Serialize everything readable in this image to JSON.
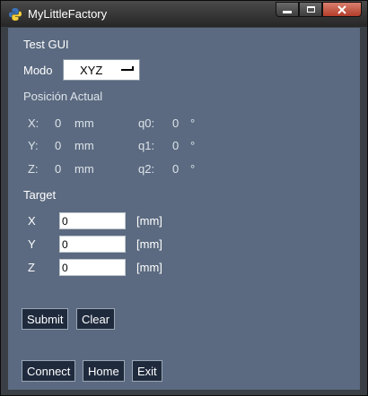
{
  "window": {
    "title": "MyLittleFactory"
  },
  "header": {
    "label": "Test GUI"
  },
  "mode": {
    "label": "Modo",
    "value": "XYZ"
  },
  "position": {
    "title": "Posición Actual",
    "rows": [
      {
        "axis": "X:",
        "value": "0",
        "unit": "mm",
        "joint": "q0:",
        "jvalue": "0",
        "junit": "°"
      },
      {
        "axis": "Y:",
        "value": "0",
        "unit": "mm",
        "joint": "q1:",
        "jvalue": "0",
        "junit": "°"
      },
      {
        "axis": "Z:",
        "value": "0",
        "unit": "mm",
        "joint": "q2:",
        "jvalue": "0",
        "junit": "°"
      }
    ]
  },
  "target": {
    "title": "Target",
    "fields": [
      {
        "label": "X",
        "value": "0",
        "unit": "[mm]"
      },
      {
        "label": "Y",
        "value": "0",
        "unit": "[mm]"
      },
      {
        "label": "Z",
        "value": "0",
        "unit": "[mm]"
      }
    ]
  },
  "buttons": {
    "submit": "Submit",
    "clear": "Clear",
    "connect": "Connect",
    "home": "Home",
    "exit": "Exit"
  },
  "colors": {
    "panel": "#5b6a80",
    "button": "#1f2a3d",
    "close": "#c24a36"
  }
}
